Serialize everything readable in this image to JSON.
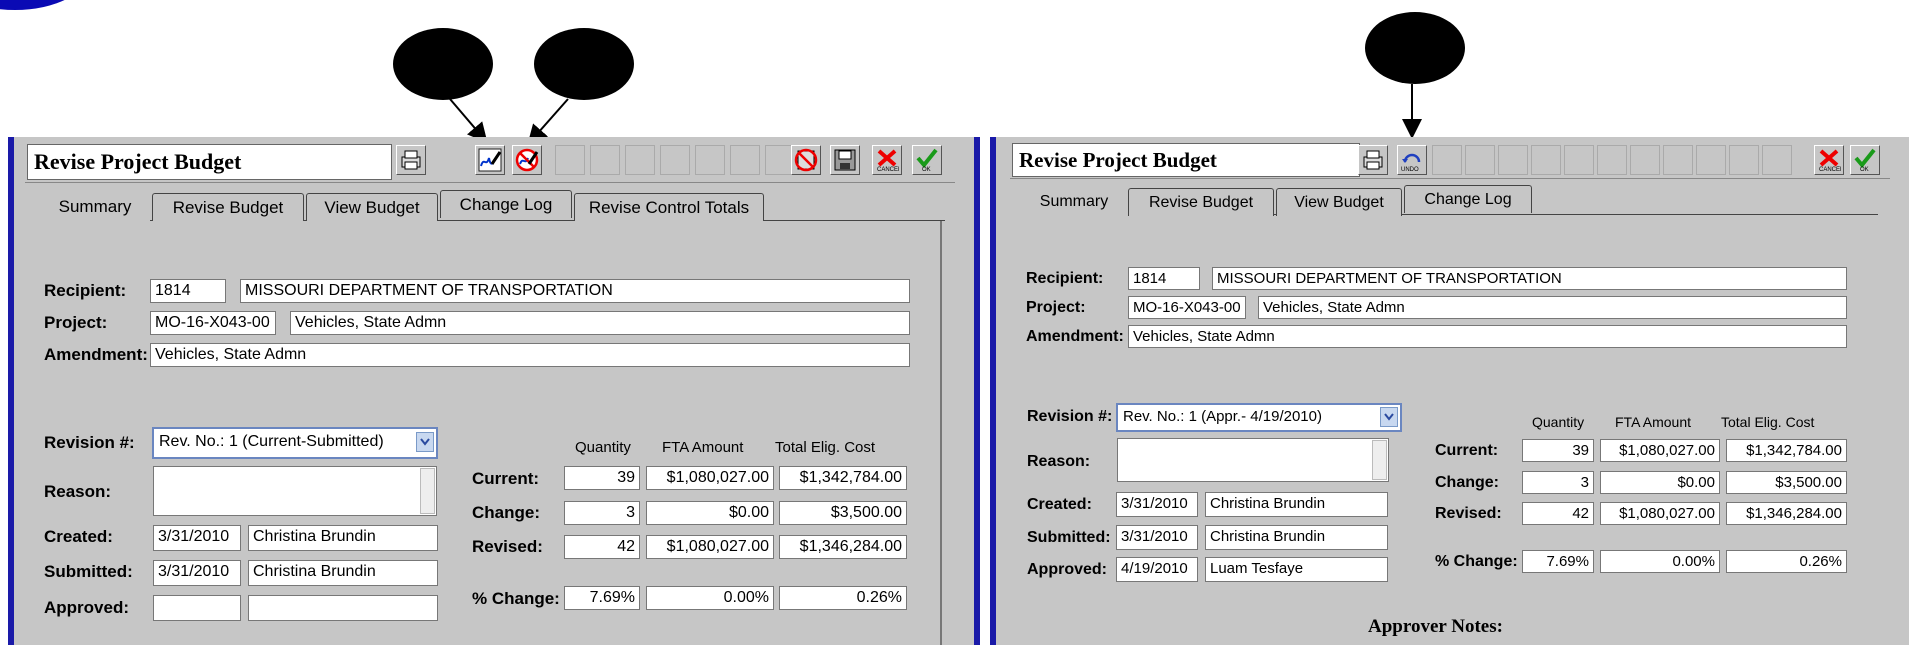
{
  "left_window": {
    "title": "Revise Project Budget",
    "tabs": [
      "Summary",
      "Revise Budget",
      "View Budget",
      "Change Log",
      "Revise Control Totals"
    ],
    "recipient_label": "Recipient:",
    "recipient_id": "1814",
    "recipient_name": "MISSOURI DEPARTMENT OF TRANSPORTATION",
    "project_label": "Project:",
    "project_id": "MO-16-X043-00",
    "project_name": "Vehicles, State Admn",
    "amendment_label": "Amendment:",
    "amendment_value": "Vehicles, State Admn",
    "revision_label": "Revision #:",
    "revision_value": "Rev. No.: 1  (Current-Submitted)",
    "reason_label": "Reason:",
    "created_label": "Created:",
    "created_date": "3/31/2010",
    "created_by": "Christina Brundin",
    "submitted_label": "Submitted:",
    "submitted_date": "3/31/2010",
    "submitted_by": "Christina Brundin",
    "approved_label": "Approved:",
    "approved_date": "",
    "approved_by": "",
    "col_quantity": "Quantity",
    "col_fta": "FTA Amount",
    "col_total": "Total Elig. Cost",
    "current_label": "Current:",
    "current": [
      "39",
      "$1,080,027.00",
      "$1,342,784.00"
    ],
    "change_label": "Change:",
    "change": [
      "3",
      "$0.00",
      "$3,500.00"
    ],
    "revised_label": "Revised:",
    "revised": [
      "42",
      "$1,080,027.00",
      "$1,346,284.00"
    ],
    "pct_label": "% Change:",
    "pct": [
      "7.69%",
      "0.00%",
      "0.26%"
    ],
    "toolbar_icons": [
      "printer-icon",
      "sign-icon",
      "unsign-icon",
      "delete-icon",
      "save-icon",
      "cancel-icon",
      "ok-icon"
    ]
  },
  "right_window": {
    "title": "Revise Project Budget",
    "tabs": [
      "Summary",
      "Revise Budget",
      "View Budget",
      "Change Log"
    ],
    "recipient_label": "Recipient:",
    "recipient_id": "1814",
    "recipient_name": "MISSOURI DEPARTMENT OF TRANSPORTATION",
    "project_label": "Project:",
    "project_id": "MO-16-X043-00",
    "project_name": "Vehicles, State Admn",
    "amendment_label": "Amendment:",
    "amendment_value": "Vehicles, State Admn",
    "revision_label": "Revision #:",
    "revision_value": "Rev. No.: 1  (Appr.- 4/19/2010)",
    "reason_label": "Reason:",
    "created_label": "Created:",
    "created_date": "3/31/2010",
    "created_by": "Christina Brundin",
    "submitted_label": "Submitted:",
    "submitted_date": "3/31/2010",
    "submitted_by": "Christina Brundin",
    "approved_label": "Approved:",
    "approved_date": "4/19/2010",
    "approved_by": "Luam Tesfaye",
    "col_quantity": "Quantity",
    "col_fta": "FTA Amount",
    "col_total": "Total Elig. Cost",
    "current_label": "Current:",
    "current": [
      "39",
      "$1,080,027.00",
      "$1,342,784.00"
    ],
    "change_label": "Change:",
    "change": [
      "3",
      "$0.00",
      "$3,500.00"
    ],
    "revised_label": "Revised:",
    "revised": [
      "42",
      "$1,080,027.00",
      "$1,346,284.00"
    ],
    "pct_label": "% Change:",
    "pct": [
      "7.69%",
      "0.00%",
      "0.26%"
    ],
    "approver_notes": "Approver Notes:",
    "toolbar_icons": [
      "printer-icon",
      "undo-icon",
      "cancel-icon",
      "ok-icon"
    ]
  }
}
